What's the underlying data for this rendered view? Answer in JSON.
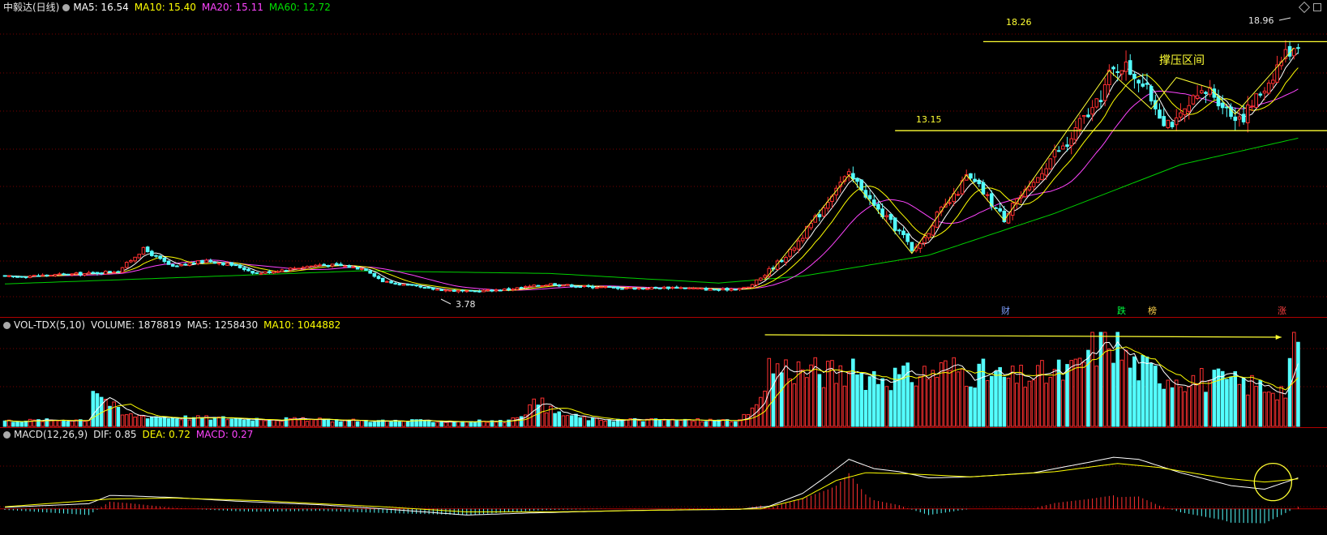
{
  "colors": {
    "background": "#000000",
    "grid": "#7a0000",
    "up": "#ff3030",
    "down": "#54ffff",
    "ma5": "#ffffff",
    "ma10": "#ffff00",
    "ma20": "#ff44ff",
    "ma60": "#00d000",
    "resistance": "#ffff33",
    "text_white": "#e8e8e8"
  },
  "header": {
    "title": "中毅达(日线)",
    "ma5": "MA5: 16.54",
    "ma10": "MA10: 15.40",
    "ma20": "MA20: 15.11",
    "ma60": "MA60: 12.72"
  },
  "vol_header": {
    "name": "VOL-TDX(5,10)",
    "volume": "VOLUME: 1878819",
    "ma5": "MA5: 1258430",
    "ma10": "MA10: 1044882"
  },
  "macd_header": {
    "name": "MACD(12,26,9)",
    "dif": "DIF: 0.85",
    "dea": "DEA: 0.72",
    "macd": "MACD: 0.27"
  },
  "annotations": {
    "resistance_high": "18.26",
    "resistance_low": "13.15",
    "zone_label": "撑压区间",
    "high_price": "18.96",
    "low_price": "3.78"
  },
  "events": [
    {
      "label": "财",
      "color": "#7f9fff"
    },
    {
      "label": "跌",
      "color": "#00ff40"
    },
    {
      "label": "榜",
      "color": "#ffd24a"
    },
    {
      "label": "涨",
      "color": "#ff4040"
    }
  ],
  "chart_data": {
    "type": "candlestick",
    "price": {
      "ylim": [
        2.5,
        20
      ],
      "resistance_lines": [
        18.26,
        13.15
      ],
      "annotated_high": 18.96,
      "annotated_low": 3.78,
      "anchors": [
        [
          0,
          4.75
        ],
        [
          20,
          4.95
        ],
        [
          27,
          5.1
        ],
        [
          33,
          6.35
        ],
        [
          40,
          5.3
        ],
        [
          48,
          5.7
        ],
        [
          55,
          5.4
        ],
        [
          60,
          4.95
        ],
        [
          70,
          5.3
        ],
        [
          75,
          5.45
        ],
        [
          80,
          5.4
        ],
        [
          86,
          5.2
        ],
        [
          90,
          4.5
        ],
        [
          100,
          4.1
        ],
        [
          110,
          3.9
        ],
        [
          120,
          4.05
        ],
        [
          130,
          4.35
        ],
        [
          138,
          4.2
        ],
        [
          150,
          4.1
        ],
        [
          160,
          4.15
        ],
        [
          170,
          4.0
        ],
        [
          177,
          4.15
        ],
        [
          180,
          4.7
        ],
        [
          187,
          6.2
        ],
        [
          194,
          8.4
        ],
        [
          198,
          10.0
        ],
        [
          201,
          10.55
        ],
        [
          204,
          9.9
        ],
        [
          207,
          8.8
        ],
        [
          210,
          8.1
        ],
        [
          214,
          7.1
        ],
        [
          216,
          6.2
        ],
        [
          219,
          7.0
        ],
        [
          222,
          8.3
        ],
        [
          226,
          9.3
        ],
        [
          229,
          10.5
        ],
        [
          232,
          9.9
        ],
        [
          234,
          9.3
        ],
        [
          238,
          8.1
        ],
        [
          240,
          9.1
        ],
        [
          244,
          9.7
        ],
        [
          247,
          10.9
        ],
        [
          250,
          11.9
        ],
        [
          253,
          12.3
        ],
        [
          256,
          13.6
        ],
        [
          260,
          14.6
        ],
        [
          263,
          16.3
        ],
        [
          266,
          17.0
        ],
        [
          270,
          16.2
        ],
        [
          273,
          15.0
        ],
        [
          276,
          13.8
        ],
        [
          279,
          13.6
        ],
        [
          283,
          14.8
        ],
        [
          287,
          15.5
        ],
        [
          290,
          14.7
        ],
        [
          292,
          14.1
        ],
        [
          295,
          14.0
        ],
        [
          298,
          15.0
        ],
        [
          301,
          16.0
        ],
        [
          304,
          17.3
        ],
        [
          308,
          18.3
        ]
      ]
    },
    "ma60": {
      "anchors": [
        [
          0,
          4.35
        ],
        [
          40,
          4.7
        ],
        [
          85,
          5.1
        ],
        [
          130,
          4.95
        ],
        [
          170,
          4.4
        ],
        [
          190,
          4.8
        ],
        [
          220,
          6.0
        ],
        [
          250,
          8.4
        ],
        [
          280,
          11.2
        ],
        [
          308,
          12.72
        ]
      ]
    },
    "volume": {
      "ylim": [
        0,
        2100000
      ],
      "last_volume": 1878819,
      "ma5_last": 1258430,
      "ma10_last": 1044882,
      "anchors": [
        [
          0,
          120000
        ],
        [
          20,
          150000
        ],
        [
          21,
          950000
        ],
        [
          24,
          600000
        ],
        [
          28,
          260000
        ],
        [
          40,
          200000
        ],
        [
          60,
          170000
        ],
        [
          90,
          120000
        ],
        [
          120,
          110000
        ],
        [
          127,
          550000
        ],
        [
          131,
          300000
        ],
        [
          140,
          150000
        ],
        [
          175,
          130000
        ],
        [
          180,
          500000
        ],
        [
          182,
          1350000
        ],
        [
          195,
          1200000
        ],
        [
          215,
          1100000
        ],
        [
          225,
          1300000
        ],
        [
          240,
          1050000
        ],
        [
          255,
          1250000
        ],
        [
          258,
          1650000
        ],
        [
          263,
          2050000
        ],
        [
          268,
          1400000
        ],
        [
          275,
          1150000
        ],
        [
          290,
          1000000
        ],
        [
          300,
          900000
        ],
        [
          305,
          800000
        ],
        [
          306,
          1450000
        ],
        [
          308,
          1878819
        ]
      ]
    },
    "macd": {
      "ylim": [
        -0.35,
        1.3
      ],
      "dif_last": 0.85,
      "dea_last": 0.72,
      "macd_last": 0.27,
      "dif_anchors": [
        [
          0,
          0.03
        ],
        [
          20,
          0.1
        ],
        [
          25,
          0.26
        ],
        [
          30,
          0.25
        ],
        [
          40,
          0.22
        ],
        [
          55,
          0.15
        ],
        [
          75,
          0.08
        ],
        [
          90,
          0.0
        ],
        [
          110,
          -0.12
        ],
        [
          125,
          -0.08
        ],
        [
          150,
          -0.03
        ],
        [
          175,
          -0.01
        ],
        [
          182,
          0.05
        ],
        [
          190,
          0.3
        ],
        [
          196,
          0.65
        ],
        [
          201,
          0.96
        ],
        [
          207,
          0.78
        ],
        [
          213,
          0.72
        ],
        [
          220,
          0.6
        ],
        [
          230,
          0.62
        ],
        [
          245,
          0.7
        ],
        [
          258,
          0.9
        ],
        [
          264,
          1.0
        ],
        [
          270,
          0.96
        ],
        [
          280,
          0.7
        ],
        [
          292,
          0.45
        ],
        [
          300,
          0.38
        ],
        [
          308,
          0.6
        ]
      ],
      "dea_anchors": [
        [
          0,
          0.04
        ],
        [
          25,
          0.19
        ],
        [
          40,
          0.21
        ],
        [
          60,
          0.16
        ],
        [
          90,
          0.04
        ],
        [
          110,
          -0.06
        ],
        [
          130,
          -0.06
        ],
        [
          160,
          -0.02
        ],
        [
          180,
          0.0
        ],
        [
          190,
          0.2
        ],
        [
          198,
          0.55
        ],
        [
          205,
          0.7
        ],
        [
          215,
          0.68
        ],
        [
          230,
          0.62
        ],
        [
          250,
          0.72
        ],
        [
          265,
          0.88
        ],
        [
          275,
          0.8
        ],
        [
          290,
          0.6
        ],
        [
          300,
          0.52
        ],
        [
          308,
          0.58
        ]
      ]
    }
  }
}
